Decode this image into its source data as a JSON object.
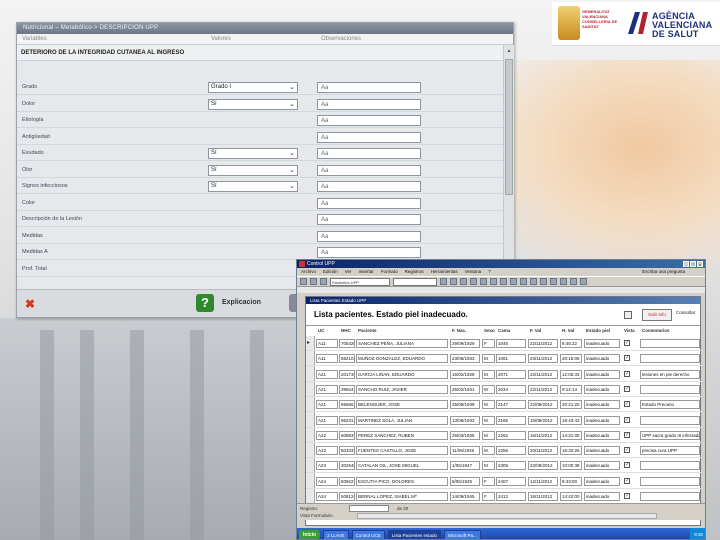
{
  "logos": {
    "gva_text": "GENERALITAT VALENCIANA CONSELLERIA DE SANITAT",
    "av_title_1": "AGÈNCIA",
    "av_title_2": "VALENCIANA",
    "av_title_3": "DE SALUT"
  },
  "form": {
    "title": "Nutricional – Metabólico-> DESCRIPCION UPP",
    "col_variables": "Variables",
    "col_valores": "Valores",
    "col_observaciones": "Observaciones",
    "section": "DETERIORO DE LA INTEGRIDAD CUTANEA AL INGRESO",
    "obs_placeholder": "Aa",
    "rows": [
      {
        "label": "Grado",
        "value": "Grado I"
      },
      {
        "label": "Dolor",
        "value": "Sí"
      },
      {
        "label": "Etiología",
        "value": null
      },
      {
        "label": "Antigüedad",
        "value": null
      },
      {
        "label": "Exudado",
        "value": "Sí"
      },
      {
        "label": "Olor",
        "value": "Sí"
      },
      {
        "label": "Signos infecciosos",
        "value": "Sí"
      },
      {
        "label": "Color",
        "value": null
      },
      {
        "label": "Descripción de la Lesión",
        "value": null
      },
      {
        "label": "Medidas",
        "value": null
      },
      {
        "label": "Medidas A",
        "value": null
      },
      {
        "label": "Prof. Total",
        "value": null
      }
    ],
    "help_label": "Explicacion"
  },
  "app": {
    "title": "Control UPP",
    "menu": [
      "Archivo",
      "Edición",
      "Ver",
      "Insertar",
      "Formato",
      "Registros",
      "Herramientas",
      "Ventana",
      "?"
    ],
    "menu_right": "Escriba una pregunta",
    "toolbar_combo": "Pacientes UPP",
    "subwindow_title": "Lista Pacientes Estado UPP",
    "heading": "Lista pacientes. Estado piel inadecuado.",
    "btn_red": "Salir Info",
    "btn_right": "Consultar",
    "columns": [
      "UC",
      "NHC",
      "Paciente",
      "F. Nac.",
      "Sexo",
      "Cama",
      "F. Val",
      "H. Val",
      "Estado piel",
      "Vista",
      "Comentarios"
    ],
    "rows": [
      {
        "uc": "A11",
        "nhc": "705420",
        "pac": "SANCHEZ PEÑA, JULIANA",
        "fnac": "29/09/1929",
        "sexo": "F",
        "cama": "1046",
        "fval": "22/11/2012",
        "hval": "8:45:22",
        "estado": "inadecuado",
        "vista": "✓",
        "com": ""
      },
      {
        "uc": "A11",
        "nhc": "582103",
        "pac": "MUÑOZ GONZALEZ, EDUARDO",
        "fnac": "23/06/1933",
        "sexo": "M",
        "cama": "1061",
        "fval": "23/11/2012",
        "hval": "20:15:05",
        "estado": "inadecuado",
        "vista": "✓",
        "com": ""
      },
      {
        "uc": "A21",
        "nhc": "201736",
        "pac": "GARCIA LIÑAN, EDUARDO",
        "fnac": "15/02/1928",
        "sexo": "M",
        "cama": "2071",
        "fval": "22/11/2012",
        "hval": "12:05:33",
        "estado": "inadecuado",
        "vista": "✓",
        "com": "lesiones en pie derecho"
      },
      {
        "uc": "A21",
        "nhc": "398241",
        "pac": "SANCHO RUIZ, JAVIER",
        "fnac": "25/02/1931",
        "sexo": "M",
        "cama": "2034",
        "fval": "22/11/2012",
        "hval": "9:12:14",
        "estado": "inadecuado",
        "vista": "✓",
        "com": ""
      },
      {
        "uc": "A21",
        "nhc": "85665",
        "pac": "BELENGUER, JOSE",
        "fnac": "25/09/1939",
        "sexo": "M",
        "cama": "2147",
        "fval": "22/09/2012",
        "hval": "20:21:20",
        "estado": "inadecuado",
        "vista": "✓",
        "com": "Estado Precario"
      },
      {
        "uc": "A21",
        "nhc": "95231",
        "pac": "MARTINEZ SOLA, JULIAN",
        "fnac": "13/08/1933",
        "sexo": "M",
        "cama": "2165",
        "fval": "15/09/2012",
        "hval": "18:43:43",
        "estado": "inadecuado",
        "vista": "✓",
        "com": ""
      },
      {
        "uc": "A22",
        "nhc": "608837",
        "pac": "PEREZ SANCHEZ, RUBEN",
        "fnac": "26/03/1935",
        "sexo": "M",
        "cama": "2262",
        "fval": "16/11/2012",
        "hval": "14:31:00",
        "estado": "inadecuado",
        "vista": "✓",
        "com": "UPP sacra grado III infectada."
      },
      {
        "uc": "A22",
        "nhc": "503431",
        "pac": "FUENTES CASTILLO, JOSE",
        "fnac": "11/06/1926",
        "sexo": "M",
        "cama": "2256",
        "fval": "20/11/2012",
        "hval": "16:32:26",
        "estado": "inadecuado",
        "vista": "✓",
        "com": "precisa cura UPP"
      },
      {
        "uc": "A23",
        "nhc": "302640",
        "pac": "CATALAN GIL, JOSE MIGUEL",
        "fnac": "1/06/1947",
        "sexo": "M",
        "cama": "2305",
        "fval": "22/09/2012",
        "hval": "10:00:38",
        "estado": "inadecuado",
        "vista": "✓",
        "com": ""
      },
      {
        "uc": "A24",
        "nhc": "509227",
        "pac": "ESCUTIA PICO, DOLORES",
        "fnac": "5/06/1925",
        "sexo": "F",
        "cama": "2407",
        "fval": "12/11/2012",
        "hval": "8:43:00",
        "estado": "inadecuado",
        "vista": "✓",
        "com": ""
      },
      {
        "uc": "A24",
        "nhc": "508124",
        "pac": "BERNAL LOPEZ, ISABEL Mª",
        "fnac": "14/09/1945",
        "sexo": "F",
        "cama": "2412",
        "fval": "16/11/2012",
        "hval": "14:42:00",
        "estado": "inadecuado",
        "vista": "✓",
        "com": ""
      },
      {
        "uc": "A31",
        "nhc": "605328",
        "pac": "GOMEZ MARTINEZ, PEDRO",
        "fnac": "17/01/1932",
        "sexo": "M",
        "cama": "3112",
        "fval": "23/11/2012",
        "hval": "11:29:30",
        "estado": "inadecuado",
        "vista": "✓",
        "com": ""
      }
    ],
    "status_record": "Registro:",
    "status_count": "de 20",
    "status_view": "Vista Formulario",
    "taskbar": {
      "start": "Inicio",
      "tasks": [
        "2 LLAVE",
        "Control UCE",
        "Lista Pacientes estado",
        "Microsoft Pa..."
      ],
      "clock": "9:30"
    }
  },
  "colors": {
    "brand_blue": "#1d2f7e",
    "brand_red": "#b22233",
    "accent_orange": "#f0c9a0"
  }
}
